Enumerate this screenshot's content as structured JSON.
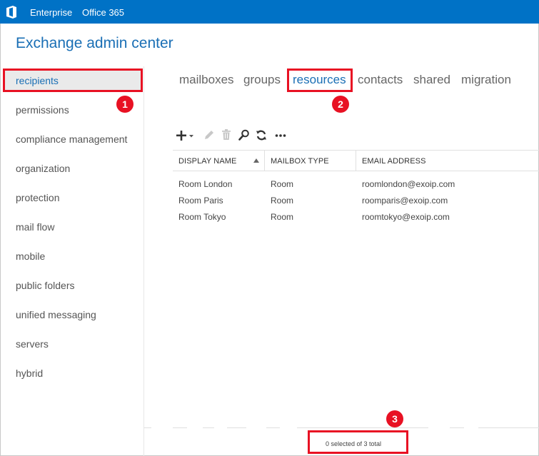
{
  "topbar": {
    "brand1": "Enterprise",
    "brand2": "Office 365",
    "accent": "#0072c6"
  },
  "app": {
    "title": "Exchange admin center"
  },
  "sidebar": {
    "items": [
      {
        "label": "recipients",
        "selected": true
      },
      {
        "label": "permissions"
      },
      {
        "label": "compliance management"
      },
      {
        "label": "organization"
      },
      {
        "label": "protection"
      },
      {
        "label": "mail flow"
      },
      {
        "label": "mobile"
      },
      {
        "label": "public folders"
      },
      {
        "label": "unified messaging"
      },
      {
        "label": "servers"
      },
      {
        "label": "hybrid"
      }
    ]
  },
  "tabs": [
    {
      "label": "mailboxes"
    },
    {
      "label": "groups"
    },
    {
      "label": "resources",
      "selected": true
    },
    {
      "label": "contacts"
    },
    {
      "label": "shared"
    },
    {
      "label": "migration"
    }
  ],
  "toolbar": {
    "icons": [
      "add-icon",
      "edit-icon",
      "delete-icon",
      "search-icon",
      "refresh-icon",
      "more-icon"
    ]
  },
  "table": {
    "columns": [
      "DISPLAY NAME",
      "MAILBOX TYPE",
      "EMAIL ADDRESS"
    ],
    "rows": [
      [
        "Room London",
        "Room",
        "roomlondon@exoip.com"
      ],
      [
        "Room Paris",
        "Room",
        "roomparis@exoip.com"
      ],
      [
        "Room Tokyo",
        "Room",
        "roomtokyo@exoip.com"
      ]
    ]
  },
  "status": {
    "text": "0 selected of 3 total"
  },
  "annotations": {
    "badge1": "1",
    "badge2": "2",
    "badge3": "3",
    "color": "#e81123"
  }
}
